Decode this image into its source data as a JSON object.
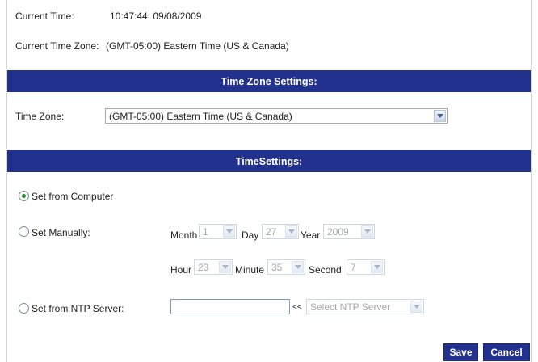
{
  "status": {
    "current_time_label": "Current Time:",
    "current_time_value": "10:47:44  09/08/2009",
    "current_tz_label": "Current Time Zone:",
    "current_tz_value": "(GMT-05:00) Eastern Time (US & Canada)"
  },
  "timezone_section": {
    "header": "Time Zone Settings:",
    "label": "Time Zone:",
    "selected": "(GMT-05:00) Eastern Time (US & Canada)"
  },
  "time_section": {
    "header": "TimeSettings:",
    "options": {
      "computer": "Set from Computer",
      "manual": "Set Manually:",
      "ntp": "Set from NTP Server:"
    },
    "selected_option": "computer",
    "manual": {
      "month_label": "Month",
      "month_value": "1",
      "day_label": "Day",
      "day_value": "27",
      "year_label": "Year",
      "year_value": "2009",
      "hour_label": "Hour",
      "hour_value": "23",
      "minute_label": "Minute",
      "minute_value": "35",
      "second_label": "Second",
      "second_value": "7"
    },
    "ntp": {
      "server_value": "",
      "arrow_text": "<<",
      "select_placeholder": "Select NTP Server"
    }
  },
  "actions": {
    "save": "Save",
    "cancel": "Cancel"
  },
  "colors": {
    "band": "#23318e",
    "radio_selected": "#2a8a2a"
  }
}
